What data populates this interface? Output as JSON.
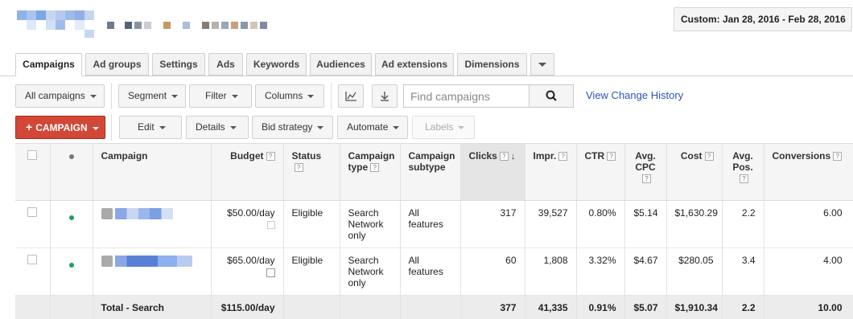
{
  "date_range": "Custom: Jan 28, 2016 - Feb 28, 2016",
  "tabs": [
    "Campaigns",
    "Ad groups",
    "Settings",
    "Ads",
    "Keywords",
    "Audiences",
    "Ad extensions",
    "Dimensions"
  ],
  "toolbar": {
    "all_campaigns": "All campaigns",
    "segment": "Segment",
    "filter": "Filter",
    "columns": "Columns",
    "search_placeholder": "Find campaigns",
    "change_history": "View Change History",
    "campaign_btn": "CAMPAIGN",
    "edit": "Edit",
    "details": "Details",
    "bid_strategy": "Bid strategy",
    "automate": "Automate",
    "labels": "Labels"
  },
  "colors": {
    "accent_red": "#d14836",
    "link_blue": "#2a55b8",
    "status_green": "#1aa260"
  },
  "columns": {
    "campaign": "Campaign",
    "budget": "Budget",
    "status": "Status",
    "campaign_type": "Campaign type",
    "campaign_subtype": "Campaign subtype",
    "clicks": "Clicks",
    "impr": "Impr.",
    "ctr": "CTR",
    "avg_cpc": "Avg. CPC",
    "cost": "Cost",
    "avg_pos": "Avg. Pos.",
    "conversions": "Conversions"
  },
  "rows": [
    {
      "budget": "$50.00/day",
      "status": "Eligible",
      "type": "Search Network only",
      "subtype": "All features",
      "clicks": "317",
      "impr": "39,527",
      "ctr": "0.80%",
      "cpc": "$5.14",
      "cost": "$1,630.29",
      "pos": "2.2",
      "conv": "6.00"
    },
    {
      "budget": "$65.00/day",
      "status": "Eligible",
      "type": "Search Network only",
      "subtype": "All features",
      "clicks": "60",
      "impr": "1,808",
      "ctr": "3.32%",
      "cpc": "$4.67",
      "cost": "$280.05",
      "pos": "3.4",
      "conv": "4.00"
    }
  ],
  "total": {
    "label": "Total - Search",
    "budget": "$115.00/day",
    "clicks": "377",
    "impr": "41,335",
    "ctr": "0.91%",
    "cpc": "$5.07",
    "cost": "$1,910.34",
    "pos": "2.2",
    "conv": "10.00"
  }
}
